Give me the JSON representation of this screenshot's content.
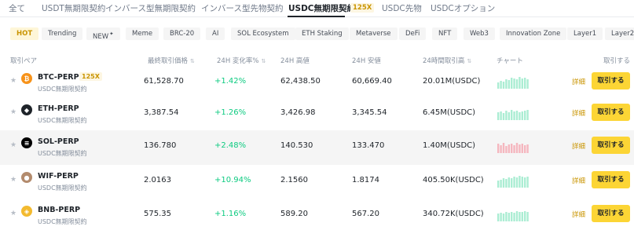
{
  "tabs": [
    {
      "label": "全て"
    },
    {
      "label": "USDT無期限契約"
    },
    {
      "label": "インバース型無期限契約"
    },
    {
      "label": "インバース型先物契約"
    },
    {
      "label": "USDC無期限契約",
      "badge": "125X"
    },
    {
      "label": "USDC先物"
    },
    {
      "label": "USDCオプション"
    }
  ],
  "chips": [
    {
      "label": "HOT"
    },
    {
      "label": "Trending"
    },
    {
      "label": "NEW",
      "sup": "✦"
    },
    {
      "label": "Meme"
    },
    {
      "label": "BRC-20"
    },
    {
      "label": "AI"
    },
    {
      "label": "SOL Ecosystem"
    },
    {
      "label": "ETH Staking"
    },
    {
      "label": "Metaverse"
    },
    {
      "label": "DeFi"
    },
    {
      "label": "NFT"
    },
    {
      "label": "Web3"
    },
    {
      "label": "Innovation Zone"
    },
    {
      "label": "Layer1"
    },
    {
      "label": "Layer2"
    }
  ],
  "columns": {
    "pair": "取引ペア",
    "last_price": "最終取引価格",
    "change": "24H 変化率%",
    "high": "24H 高値",
    "low": "24H 安値",
    "volume": "24時間取引高",
    "chart": "チャート",
    "trade": "取引する"
  },
  "rows": [
    {
      "symbol": "BTC-PERP",
      "badge": "125X",
      "sub": "USDC無期限契約",
      "last": "61,528.70",
      "change": "+1.42%",
      "high": "62,438.50",
      "low": "60,669.40",
      "volume": "20.01M(USDC)",
      "detail": "詳細",
      "trade": "取引する",
      "coin_icon": "bitcoin-icon",
      "coin_glyph": "₿",
      "coin_color": "#f7931a",
      "spark_color": "#0ecb81"
    },
    {
      "symbol": "ETH-PERP",
      "sub": "USDC無期限契約",
      "last": "3,387.54",
      "change": "+1.26%",
      "high": "3,426.98",
      "low": "3,345.54",
      "volume": "6.45M(USDC)",
      "detail": "詳細",
      "trade": "取引する",
      "coin_icon": "ethereum-icon",
      "coin_glyph": "◆",
      "coin_color": "#1e2329",
      "spark_color": "#0ecb81"
    },
    {
      "symbol": "SOL-PERP",
      "sub": "USDC無期限契約",
      "last": "136.780",
      "change": "+2.48%",
      "high": "140.530",
      "low": "133.470",
      "volume": "1.40M(USDC)",
      "detail": "詳細",
      "trade": "取引する",
      "coin_icon": "solana-icon",
      "coin_glyph": "≡",
      "coin_color": "#000000",
      "spark_color": "#f6465d"
    },
    {
      "symbol": "WIF-PERP",
      "sub": "USDC無期限契約",
      "last": "2.0163",
      "change": "+10.94%",
      "high": "2.1560",
      "low": "1.8174",
      "volume": "405.50K(USDC)",
      "detail": "詳細",
      "trade": "取引する",
      "coin_icon": "dogwifhat-icon",
      "coin_glyph": "●",
      "coin_color": "#b38b6d",
      "spark_color": "#0ecb81"
    },
    {
      "symbol": "BNB-PERP",
      "sub": "USDC無期限契約",
      "last": "575.35",
      "change": "+1.16%",
      "high": "589.20",
      "low": "567.20",
      "volume": "340.72K(USDC)",
      "detail": "詳細",
      "trade": "取引する",
      "coin_icon": "bnb-icon",
      "coin_glyph": "◈",
      "coin_color": "#f3ba2f",
      "spark_color": "#0ecb81"
    }
  ],
  "accent_color": "#fcd535",
  "positive_color": "#0ecb81"
}
